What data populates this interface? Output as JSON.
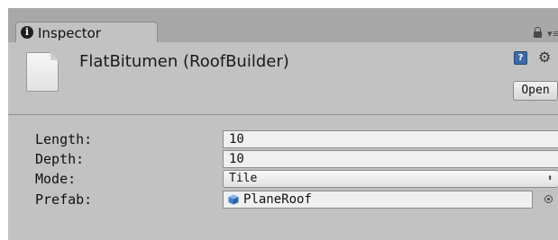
{
  "window": {
    "tab_title": "Inspector",
    "tab_icon": "info-icon",
    "toolbar_icons": [
      "lock-icon",
      "panel-menu-icon"
    ]
  },
  "header": {
    "asset_title": "FlatBitumen (RoofBuilder)",
    "asset_icon": "document-icon",
    "header_icons": [
      "help-icon",
      "gear-icon"
    ],
    "open_button_label": "Open"
  },
  "fields": [
    {
      "label": "Length:",
      "type": "text",
      "value": "10"
    },
    {
      "label": "Depth:",
      "type": "text",
      "value": "10"
    },
    {
      "label": "Mode:",
      "type": "select",
      "value": "Tile"
    },
    {
      "label": "Prefab:",
      "type": "object",
      "value": "PlaneRoof",
      "icon": "prefab-cube-icon"
    }
  ],
  "colors": {
    "panel_bg": "#c2c2c2",
    "tabstrip_bg": "#a8a8a8",
    "field_bg": "#f0f0f0",
    "prefab_icon": "#4a90d9"
  }
}
